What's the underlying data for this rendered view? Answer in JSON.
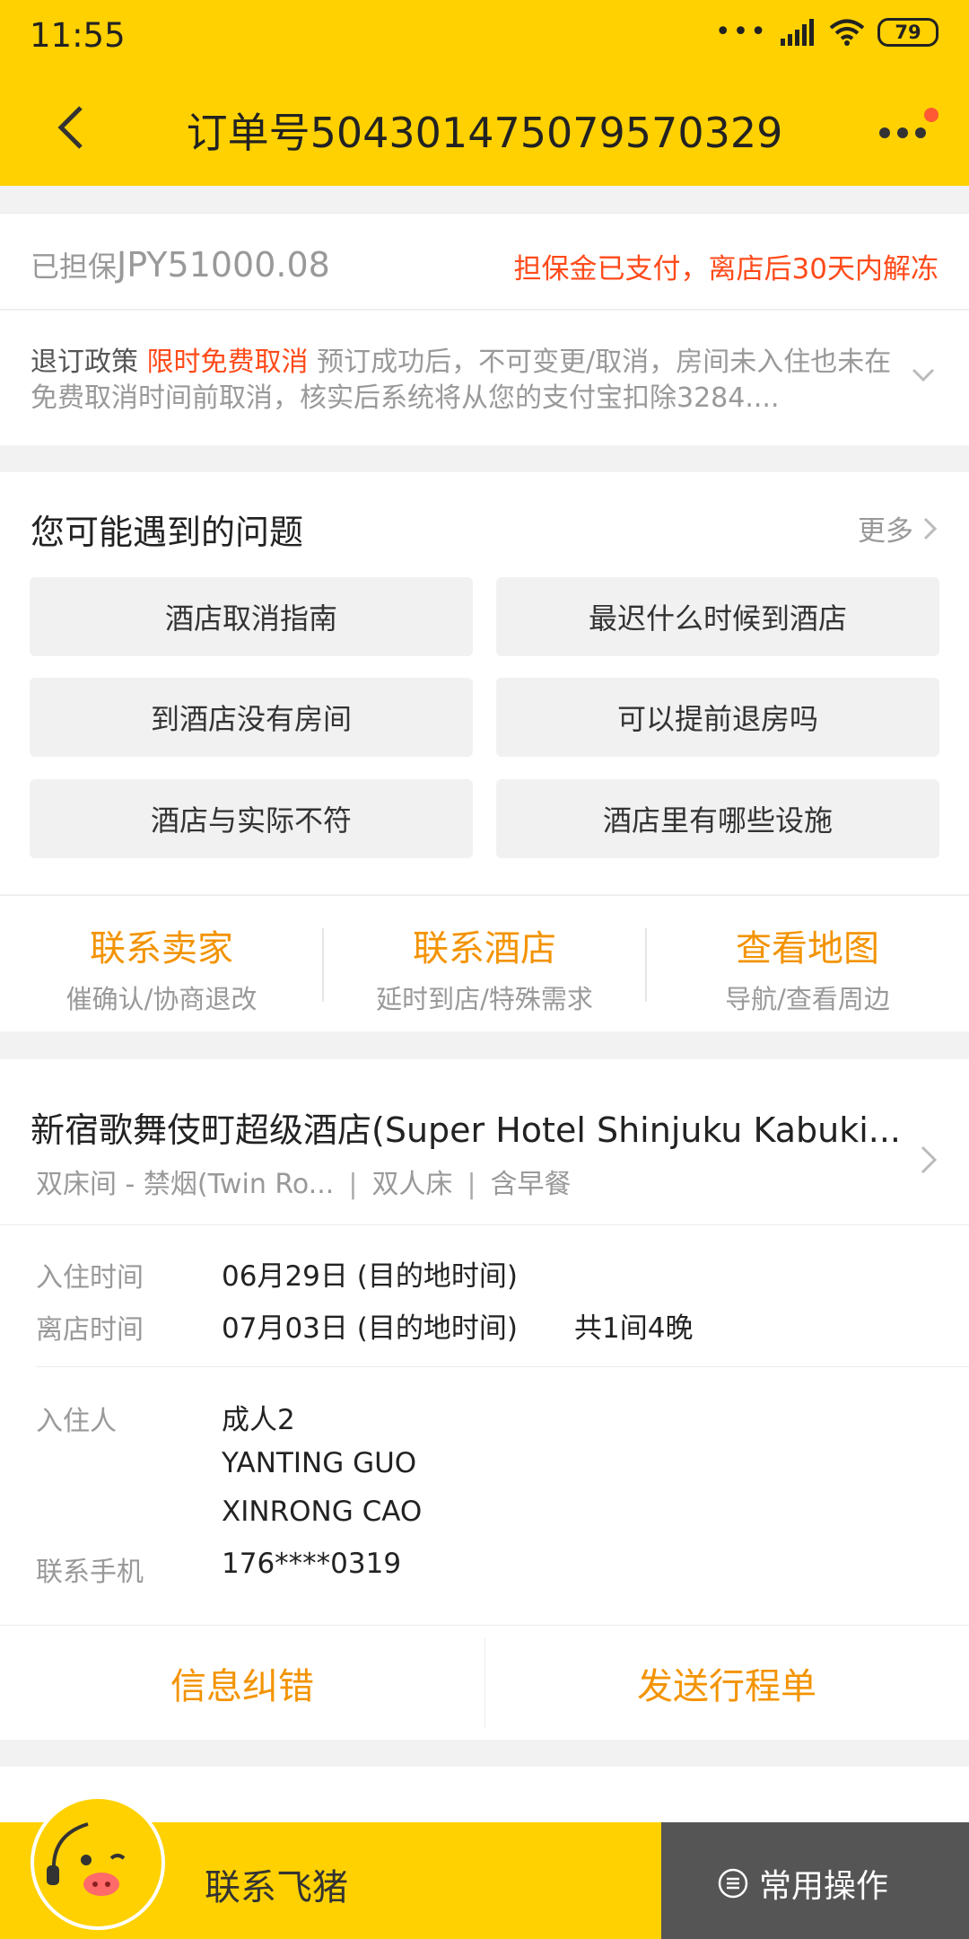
{
  "status_bar": {
    "time": "11:55",
    "battery": "79"
  },
  "header": {
    "title": "订单号5043014750795703​29"
  },
  "guarantee": {
    "label": "已担保",
    "amount": "JPY51000.08",
    "status": "担保金已支付，离店后30天内解冻"
  },
  "policy": {
    "label": "退订政策",
    "highlight": "限时免费取消",
    "text": "预订成功后，不可变更/取消，房间未入住也未在免费取消时间前取消，核实后系统将从您的支付宝扣除3284...."
  },
  "faq": {
    "title": "您可能遇到的问题",
    "more": "更多",
    "questions": [
      "酒店取消指南",
      "最迟什么时候到酒店",
      "到酒店没有房间",
      "可以提前退房吗",
      "酒店与实际不符",
      "酒店里有哪些设施"
    ]
  },
  "contact": [
    {
      "title": "联系卖家",
      "sub": "催确认/协商退改"
    },
    {
      "title": "联系酒店",
      "sub": "延时到店/特殊需求"
    },
    {
      "title": "查看地图",
      "sub": "导航/查看周边"
    }
  ],
  "hotel": {
    "name": "新宿歌舞伎町超级酒店(Super Hotel Shinjuku Kabuki...",
    "room_type": "双床间 - 禁烟(Twin Ro...",
    "bed": "双人床",
    "meal": "含早餐",
    "checkin_label": "入住时间",
    "checkin_value": "06月29日 (目的地时间)",
    "checkout_label": "离店时间",
    "checkout_value": "07月03日 (目的地时间)",
    "summary": "共1间4晚",
    "guest_label": "入住人",
    "guest_count": "成人2",
    "guests": [
      "YANTING GUO",
      "XINRONG CAO"
    ],
    "phone_label": "联系手机",
    "phone": "176****0319",
    "action_fix": "信息纠错",
    "action_send": "发送行程单"
  },
  "bottom": {
    "contact_label": "联系飞猪",
    "ops_label": "常用操作"
  },
  "colors": {
    "brand_yellow": "#ffd100",
    "accent_orange": "#f39300",
    "alert_red": "#ff4a1a"
  }
}
